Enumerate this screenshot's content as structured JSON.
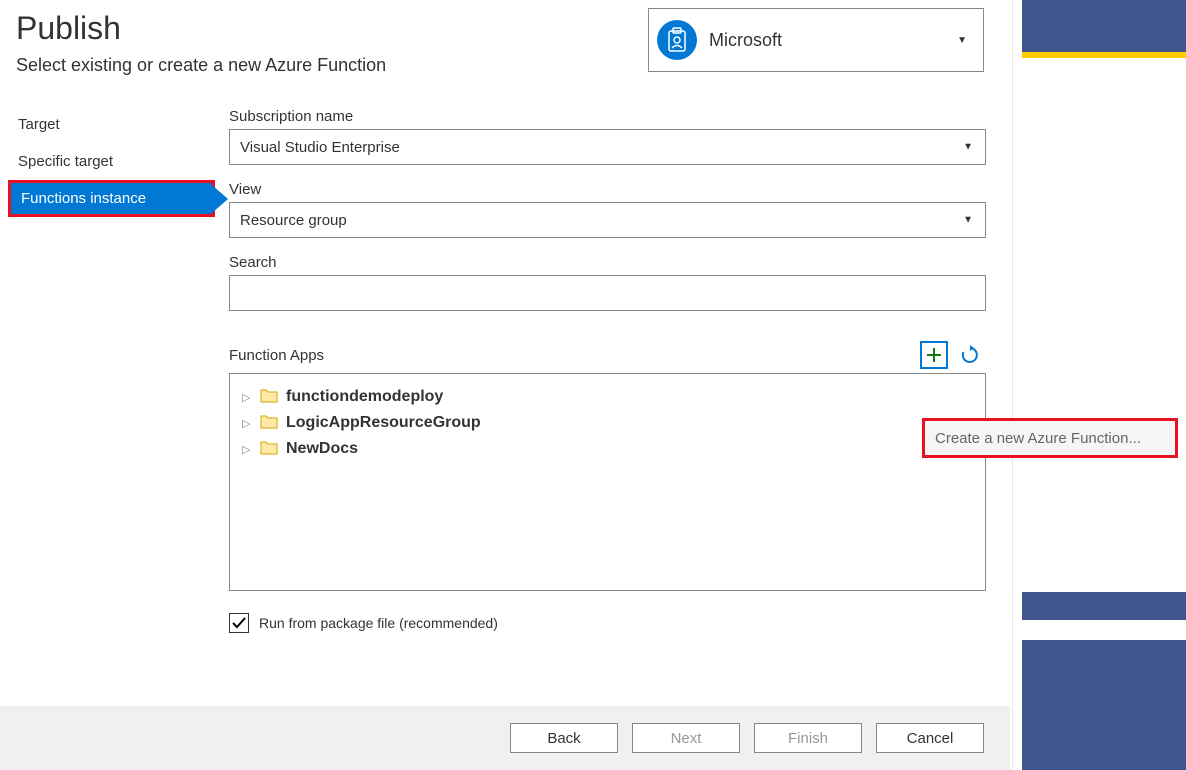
{
  "header": {
    "title": "Publish",
    "subtitle": "Select existing or create a new Azure Function"
  },
  "account": {
    "name": "Microsoft"
  },
  "nav": {
    "items": [
      "Target",
      "Specific target",
      "Functions instance"
    ],
    "selected_index": 2
  },
  "form": {
    "subscription_label": "Subscription name",
    "subscription_value": "Visual Studio Enterprise",
    "view_label": "View",
    "view_value": "Resource group",
    "search_label": "Search",
    "search_value": "",
    "function_apps_label": "Function Apps"
  },
  "tree": {
    "items": [
      "functiondemodeploy",
      "LogicAppResourceGroup",
      "NewDocs"
    ]
  },
  "checkbox": {
    "checked": true,
    "label": "Run from package file (recommended)"
  },
  "tooltip": {
    "create_new": "Create a new Azure Function..."
  },
  "buttons": {
    "back": "Back",
    "next": "Next",
    "finish": "Finish",
    "cancel": "Cancel"
  }
}
